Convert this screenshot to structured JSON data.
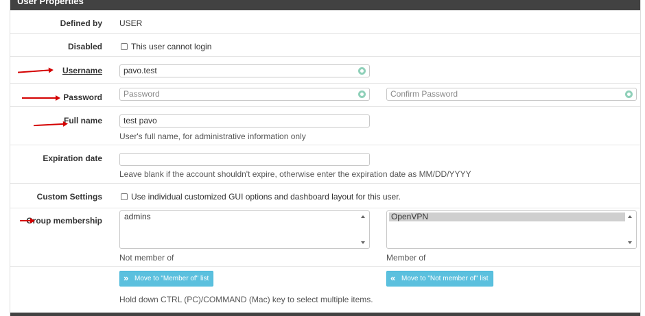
{
  "panel": {
    "title": "User Properties"
  },
  "defined_by": {
    "label": "Defined by",
    "value": "USER"
  },
  "disabled": {
    "label": "Disabled",
    "checkbox_label": "This user cannot login",
    "checked": false
  },
  "username": {
    "label": "Username",
    "value": "pavo.test"
  },
  "password": {
    "label": "Password",
    "placeholder": "Password",
    "confirm_placeholder": "Confirm Password"
  },
  "full_name": {
    "label": "Full name",
    "value": "test pavo",
    "help": "User's full name, for administrative information only"
  },
  "expiration": {
    "label": "Expiration date",
    "value": "",
    "help": "Leave blank if the account shouldn't expire, otherwise enter the expiration date as MM/DD/YYYY"
  },
  "custom_settings": {
    "label": "Custom Settings",
    "checkbox_label": "Use individual customized GUI options and dashboard layout for this user.",
    "checked": false
  },
  "groups": {
    "label": "Group membership",
    "not_member_options": [
      "admins"
    ],
    "member_options": [
      "OpenVPN"
    ],
    "not_member_caption": "Not member of",
    "member_caption": "Member of",
    "move_to_member_label": "Move to \"Member of\" list",
    "move_to_not_member_label": "Move to \"Not member of\" list",
    "help": "Hold down CTRL (PC)/COMMAND (Mac) key to select multiple items."
  },
  "icons": {
    "password_field_icon": "key-icon",
    "move_right_icon": "double-chevron-right-icon",
    "move_left_icon": "double-chevron-left-icon",
    "annotation_arrow": "red-arrow"
  },
  "colors": {
    "heading_bg": "#424242",
    "button_bg": "#5bc0de",
    "annotation": "#d40000"
  }
}
